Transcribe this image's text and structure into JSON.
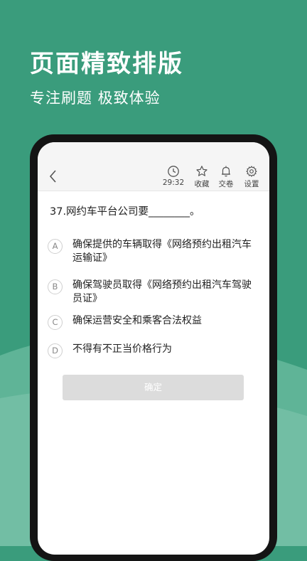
{
  "hero": {
    "title": "页面精致排版",
    "subtitle": "专注刷题 极致体验"
  },
  "toolbar": {
    "timer": "29:32",
    "favorite_label": "收藏",
    "submit_label": "交卷",
    "settings_label": "设置"
  },
  "question": {
    "text": "37.网约车平台公司要________。",
    "options": [
      {
        "letter": "A",
        "text": "确保提供的车辆取得《网络预约出租汽车运输证》"
      },
      {
        "letter": "B",
        "text": "确保驾驶员取得《网络预约出租汽车驾驶员证》"
      },
      {
        "letter": "C",
        "text": "确保运营安全和乘客合法权益"
      },
      {
        "letter": "D",
        "text": "不得有不正当价格行为"
      }
    ],
    "confirm_label": "确定"
  },
  "colors": {
    "brand": "#3a9c7c",
    "brand_light": "#6cbba0",
    "phone_frame": "#141414"
  },
  "icons": [
    "back-arrow-icon",
    "clock-icon",
    "star-icon",
    "bell-icon",
    "gear-icon"
  ]
}
